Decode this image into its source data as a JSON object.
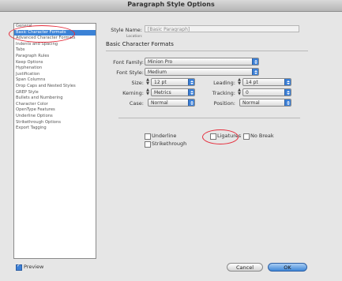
{
  "window": {
    "title": "Paragraph Style Options"
  },
  "sidebar": {
    "items": [
      {
        "label": "General",
        "selected": false
      },
      {
        "label": "Basic Character Formats",
        "selected": true
      },
      {
        "label": "Advanced Character Formats",
        "selected": false
      },
      {
        "label": "Indents and Spacing",
        "selected": false
      },
      {
        "label": "Tabs",
        "selected": false
      },
      {
        "label": "Paragraph Rules",
        "selected": false
      },
      {
        "label": "Keep Options",
        "selected": false
      },
      {
        "label": "Hyphenation",
        "selected": false
      },
      {
        "label": "Justification",
        "selected": false
      },
      {
        "label": "Span Columns",
        "selected": false
      },
      {
        "label": "Drop Caps and Nested Styles",
        "selected": false
      },
      {
        "label": "GREP Style",
        "selected": false
      },
      {
        "label": "Bullets and Numbering",
        "selected": false
      },
      {
        "label": "Character Color",
        "selected": false
      },
      {
        "label": "OpenType Features",
        "selected": false
      },
      {
        "label": "Underline Options",
        "selected": false
      },
      {
        "label": "Strikethrough Options",
        "selected": false
      },
      {
        "label": "Export Tagging",
        "selected": false
      }
    ]
  },
  "main": {
    "style_name_label": "Style Name:",
    "style_name_value": "[Basic Paragraph]",
    "location_label": "Location:",
    "section_title": "Basic Character Formats",
    "font_family_label": "Font Family:",
    "font_family_value": "Minion Pro",
    "font_style_label": "Font Style:",
    "font_style_value": "Medium",
    "size_label": "Size:",
    "size_value": "12 pt",
    "leading_label": "Leading:",
    "leading_value": "14 pt",
    "kerning_label": "Kerning:",
    "kerning_value": "Metrics",
    "tracking_label": "Tracking:",
    "tracking_value": "0",
    "case_label": "Case:",
    "case_value": "Normal",
    "position_label": "Position:",
    "position_value": "Normal",
    "underline_label": "Underline",
    "underline_checked": false,
    "ligatures_label": "Ligatures",
    "ligatures_checked": false,
    "no_break_label": "No Break",
    "no_break_checked": false,
    "strikethrough_label": "Strikethrough",
    "strikethrough_checked": false
  },
  "footer": {
    "preview_label": "Preview",
    "preview_checked": true,
    "cancel_label": "Cancel",
    "ok_label": "OK"
  },
  "colors": {
    "accent": "#3b82d6",
    "annotation": "#e52b3a"
  }
}
